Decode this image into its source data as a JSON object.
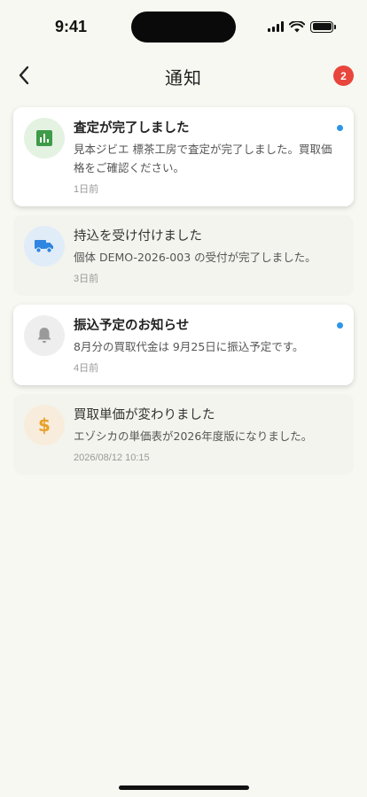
{
  "status_bar": {
    "time": "9:41"
  },
  "header": {
    "title": "通知",
    "unread_count": "2"
  },
  "notifications": [
    {
      "title": "査定が完了しました",
      "body": "見本ジビエ 標茶工房で査定が完了しました。買取価格をご確認ください。",
      "time": "1日前",
      "unread": true,
      "icon": "chart-icon",
      "icon_color": "#3e9b48",
      "icon_bg": "#e4f2e2"
    },
    {
      "title": "持込を受け付けました",
      "body": "個体 DEMO-2026-003 の受付が完了しました。",
      "time": "3日前",
      "unread": false,
      "icon": "truck-icon",
      "icon_color": "#2f86e0",
      "icon_bg": "#e0ecf8"
    },
    {
      "title": "振込予定のお知らせ",
      "body": "8月分の買取代金は 9月25日に振込予定です。",
      "time": "4日前",
      "unread": true,
      "icon": "bell-icon",
      "icon_color": "#9a9a9a",
      "icon_bg": "#eeeeee"
    },
    {
      "title": "買取単価が変わりました",
      "body": "エゾシカの単価表が2026年度版になりました。",
      "time": "2026/08/12 10:15",
      "unread": false,
      "icon": "dollar-icon",
      "icon_color": "#e8a12a",
      "icon_bg": "#f8ecdc"
    }
  ],
  "colors": {
    "accent_dot": "#2e95e8",
    "badge": "#e8453c",
    "background": "#f7f8f1"
  }
}
